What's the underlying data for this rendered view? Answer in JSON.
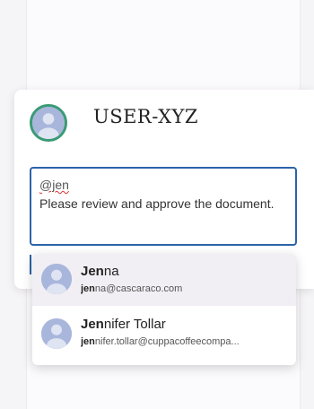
{
  "card": {
    "username": "USER-XYZ",
    "avatar_icon": "user-avatar-icon"
  },
  "comment": {
    "mention": "@jen",
    "text": "Please review and approve the document."
  },
  "suggestions": [
    {
      "name_match": "Jen",
      "name_rest": "na",
      "email_match": "jen",
      "email_rest": "na@cascaraco.com",
      "highlighted": true
    },
    {
      "name_match": "Jen",
      "name_rest": "nifer Tollar",
      "email_match": "jen",
      "email_rest": "nifer.tollar@cuppacoffeecompa...",
      "highlighted": false
    }
  ],
  "colors": {
    "accent": "#2c63a9",
    "avatar_ring": "#3a9b74",
    "avatar_fill": "#a9b6dc"
  }
}
